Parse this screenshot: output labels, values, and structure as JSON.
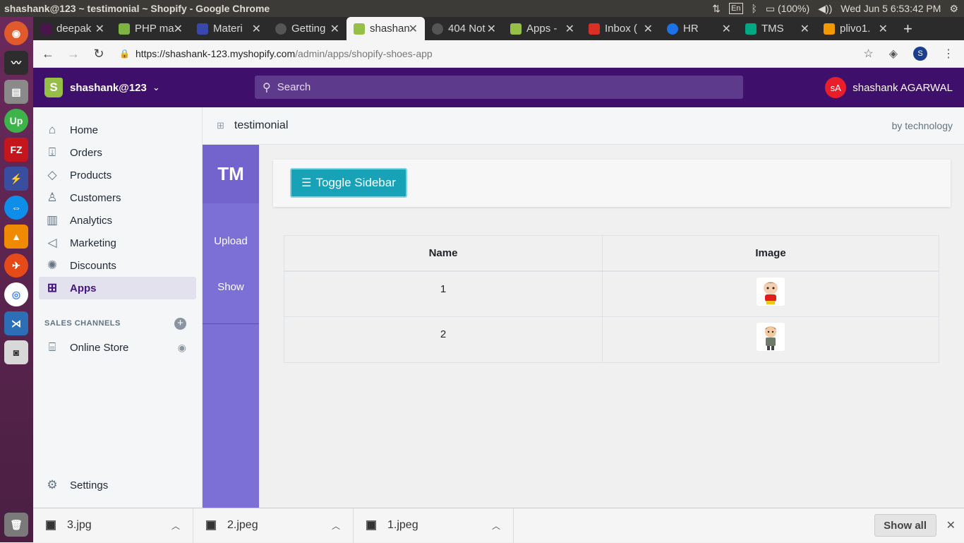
{
  "os": {
    "window_title": "shashank@123 ~ testimonial ~ Shopify - Google Chrome",
    "lang": "En",
    "battery": "(100%)",
    "datetime": "Wed Jun  5  6:53:42 PM"
  },
  "tabs": [
    {
      "label": "deepak",
      "color": "#4a154b"
    },
    {
      "label": "PHP mail",
      "color": "#7cb342"
    },
    {
      "label": "Materi",
      "color": "#3949ab"
    },
    {
      "label": "Getting",
      "color": "#555555"
    },
    {
      "label": "shashank",
      "color": "#95bf47",
      "active": true
    },
    {
      "label": "404 Not",
      "color": "#555555"
    },
    {
      "label": "Apps -",
      "color": "#95bf47"
    },
    {
      "label": "Inbox (",
      "color": "#d93025"
    },
    {
      "label": "HR",
      "color": "#1a73e8"
    },
    {
      "label": "TMS",
      "color": "#00a884"
    },
    {
      "label": "plivo1.",
      "color": "#f29900"
    }
  ],
  "browser": {
    "url_host": "https://shashank-123.myshopify.com",
    "url_path": "/admin/apps/shopify-shoes-app",
    "profile_initial": "S"
  },
  "shopify": {
    "store_name": "shashank@123",
    "search_placeholder": "Search",
    "user_initials": "sA",
    "user_name": "shashank AGARWAL",
    "nav": [
      {
        "label": "Home",
        "icon": "home-icon"
      },
      {
        "label": "Orders",
        "icon": "orders-icon"
      },
      {
        "label": "Products",
        "icon": "tag-icon"
      },
      {
        "label": "Customers",
        "icon": "customer-icon"
      },
      {
        "label": "Analytics",
        "icon": "analytics-icon"
      },
      {
        "label": "Marketing",
        "icon": "megaphone-icon"
      },
      {
        "label": "Discounts",
        "icon": "discount-icon"
      },
      {
        "label": "Apps",
        "icon": "apps-icon",
        "active": true
      }
    ],
    "sales_channels_heading": "SALES CHANNELS",
    "online_store_label": "Online Store",
    "settings_label": "Settings"
  },
  "app": {
    "title": "testimonial",
    "byline": "by technology",
    "brand": "TM",
    "links": [
      "Upload",
      "Show"
    ],
    "toggle_label": "Toggle Sidebar",
    "table": {
      "headers": [
        "Name",
        "Image"
      ],
      "rows": [
        {
          "name": "1",
          "image": "cartoon-kid-thumbnail"
        },
        {
          "name": "2",
          "image": "cartoon-boy-thumbnail"
        }
      ]
    }
  },
  "downloads": {
    "items": [
      "3.jpg",
      "2.jpeg",
      "1.jpeg"
    ],
    "show_all": "Show all"
  }
}
